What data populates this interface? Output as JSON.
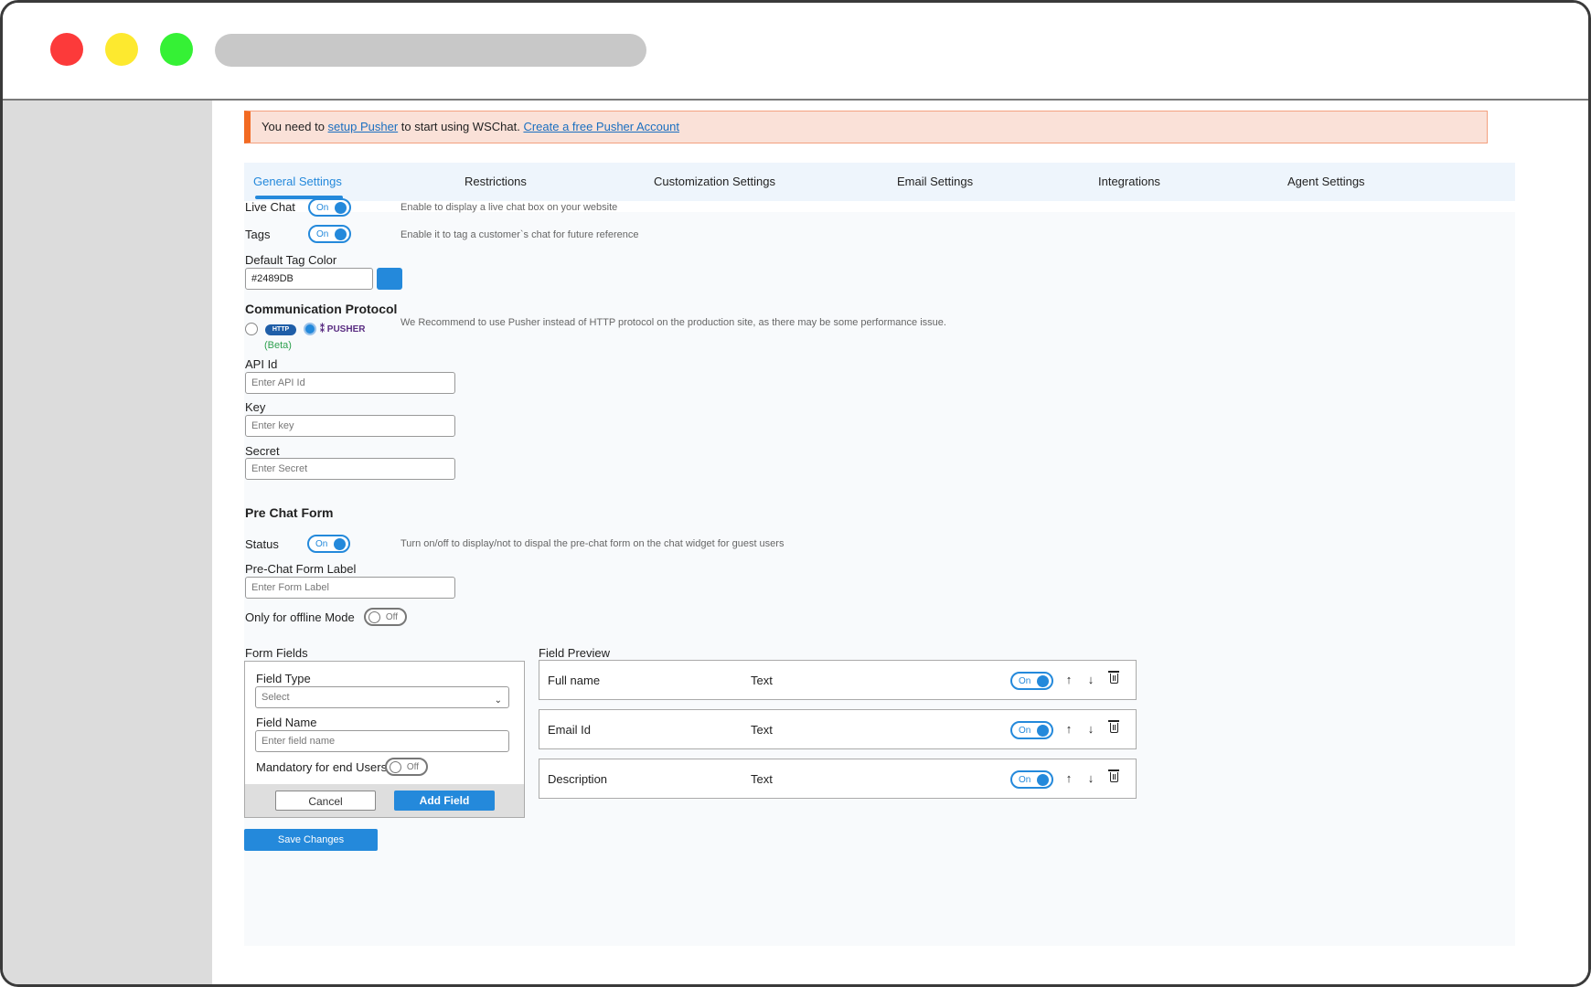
{
  "notice": {
    "prefix": "You need to ",
    "link1": "setup Pusher",
    "middle": " to start using WSChat. ",
    "link2": "Create a free Pusher Account"
  },
  "tabs": [
    "General Settings",
    "Restrictions",
    "Customization Settings",
    "Email Settings",
    "Integrations",
    "Agent Settings"
  ],
  "general": {
    "live_chat_label": "Live Chat",
    "live_chat_hint": "Enable to display a live chat box on your website",
    "tags_label": "Tags",
    "tags_hint": "Enable it to tag a customer`s chat for future reference",
    "default_tag_color_label": "Default Tag Color",
    "default_tag_color_value": "#2489DB",
    "toggle_on": "On",
    "toggle_off": "Off"
  },
  "protocol": {
    "title": "Communication Protocol",
    "http_logo": "HTTP",
    "pusher_logo": "PUSHER",
    "beta": "(Beta)",
    "hint": "We Recommend to use Pusher instead of HTTP protocol on the production site, as there may be some performance issue.",
    "api_id_label": "API Id",
    "api_id_placeholder": "Enter API Id",
    "key_label": "Key",
    "key_placeholder": "Enter key",
    "secret_label": "Secret",
    "secret_placeholder": "Enter Secret"
  },
  "prechat": {
    "title": "Pre Chat Form",
    "status_label": "Status",
    "status_hint": "Turn on/off to display/not to dispal the pre-chat form on the chat widget for guest users",
    "form_label_label": "Pre-Chat Form Label",
    "form_label_placeholder": "Enter Form Label",
    "offline_label": "Only for offline Mode"
  },
  "form_fields": {
    "title": "Form Fields",
    "field_type_label": "Field Type",
    "field_type_value": "Select",
    "field_name_label": "Field Name",
    "field_name_placeholder": "Enter field name",
    "mandatory_label": "Mandatory for end Users",
    "cancel": "Cancel",
    "add_field": "Add Field"
  },
  "preview": {
    "title": "Field Preview",
    "rows": [
      {
        "name": "Full name",
        "type": "Text"
      },
      {
        "name": "Email Id",
        "type": "Text"
      },
      {
        "name": "Description",
        "type": "Text"
      }
    ]
  },
  "save_label": "Save Changes",
  "colors": {
    "accent": "#2489DB",
    "notice_bg": "#FAE1D8",
    "notice_border": "#F26A22",
    "beta": "#2EA04F"
  }
}
